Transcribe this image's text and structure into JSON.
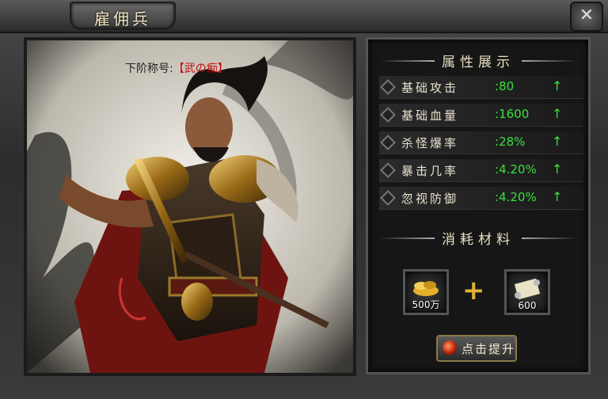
{
  "window": {
    "title": "雇佣兵",
    "close_icon": "close-icon"
  },
  "hero": {
    "rank_prefix": "下阶称号:",
    "rank_value": "【武の痴】"
  },
  "attributes": {
    "header": "属性展示",
    "items": [
      {
        "name": "基础攻击",
        "value": "80",
        "arrow": "up-arrow-icon"
      },
      {
        "name": "基础血量",
        "value": "1600",
        "arrow": "up-arrow-icon"
      },
      {
        "name": "杀怪爆率",
        "value": "28%",
        "arrow": "up-arrow-icon"
      },
      {
        "name": "暴击几率",
        "value": "4.20%",
        "arrow": "up-arrow-icon"
      },
      {
        "name": "忽视防御",
        "value": "4.20%",
        "arrow": "up-arrow-icon"
      }
    ]
  },
  "materials": {
    "header": "消耗材料",
    "gold": {
      "icon": "gold-ingot-icon",
      "qty": "500万"
    },
    "plus": "+",
    "scroll": {
      "icon": "scroll-icon",
      "qty": "600"
    }
  },
  "upgrade_button": {
    "label": "点击提升"
  },
  "colors": {
    "stat_value": "#38e13b",
    "rank_value": "#c60b0b",
    "accent_gold": "#e0b333"
  }
}
